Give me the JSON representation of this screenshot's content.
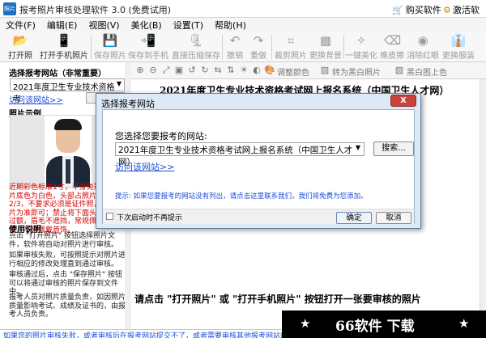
{
  "window": {
    "title": "报考照片审核处理软件 3.0 (免费试用)",
    "app_icon_text": "照片",
    "buy_label": "购买软件",
    "activate_label": "激活软件"
  },
  "menu": [
    "文件(F)",
    "编辑(E)",
    "视图(V)",
    "美化(B)",
    "设置(T)",
    "帮助(H)"
  ],
  "toolbar": {
    "open_photo": "打开照片",
    "open_phone_photo": "打开手机照片",
    "save_photo": "保存照片",
    "save_to_phone": "保存到手机",
    "save_compressed": "直接压缩保存",
    "undo": "撤销",
    "redo": "重做",
    "crop_photo": "裁剪照片",
    "change_bg": "更换背景",
    "beautify": "一键美化",
    "eraser": "橡皮擦",
    "remove_red_eye": "消除红眼",
    "change_clothes": "更换服装"
  },
  "left_panel": {
    "site_title": "选择报考网站（非常重要）",
    "site_value": "2021年度卫生专业技术资格考",
    "visit_link": "访问该网站>>",
    "sample_title": "照片示例",
    "red_note": "近期彩色标准1寸，半身免冠正面照片底色为白色，头部占照片尺寸的2/3，不要求必须是证件照，本人照片为准即可；禁止将下面头发不得过额，眉毛不遮挡，常规佩戴眼镜，不得佩戴首饰。",
    "usage_title": "使用说明",
    "help_1": "点击 \"打开照片\" 按钮选择照片文件，软件将自动对照片进行审核。",
    "help_2": "如果审核失败，可按照提示对照片进行相应的修改处理直到通过审核。",
    "help_3": "审核通过后，点击 \"保存照片\" 按钮可以将通过审核的照片保存到文件中。",
    "help_4": "报考人员对照片质量负责，如因照片质量影响考试、成绩及证书的，由报考人员负责。"
  },
  "content_toolbar": {
    "adjust_color": "调整颜色",
    "to_bw": "转为黑白照片",
    "bw_to_color": "黑白图上色"
  },
  "content": {
    "heading": "2021年度卫生专业技术资格考试网上报名系统（中国卫生人才网）",
    "instruction": "请点击 \"打开照片\" 或 \"打开手机照片\" 按钮打开一张要审核的照片"
  },
  "status": {
    "text": "如果您的照片审核失败，或者审核后在报考网站提交不了，或者需要审核其他报考网站的照片，请先选择报考网站"
  },
  "watermark": {
    "text": "66软件 下载"
  },
  "dialog": {
    "title": "选择报考网站",
    "close_label": "X",
    "prompt": "您选择您要报考的网站:",
    "site_value": "2021年度卫生专业技术资格考试网上报名系统（中国卫生人才网）",
    "browse_label": "搜索...",
    "visit_link": "访问该网站>>",
    "hint": "提示: 如果您要报考的网站没有列出，请点击这里联系我们，我们将免费为您添加。",
    "checkbox_label": "下次启动时不再提示",
    "ok_label": "确定",
    "cancel_label": "取消"
  }
}
